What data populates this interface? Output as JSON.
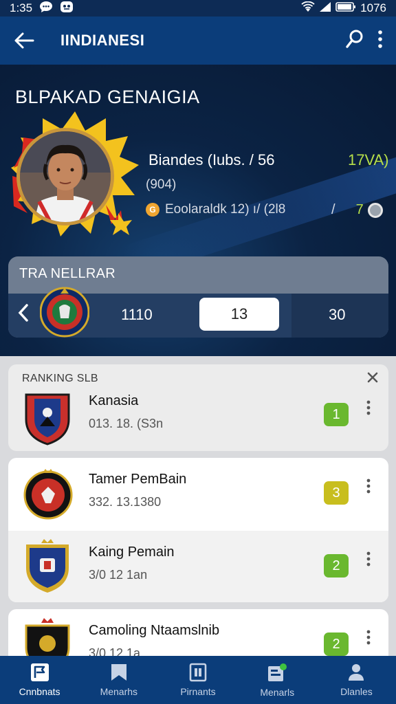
{
  "status_bar": {
    "time": "1:35",
    "battery_text": "1076"
  },
  "app_bar": {
    "title": "IINDIANESI"
  },
  "hero": {
    "title": "BLPAKAD GENAIGIA",
    "stat1": "Biandes (Iubs. /  56",
    "stat1_right": "17VA)",
    "stat2": "(904)",
    "stat3": "Eoolaraldk 12) ı/ (2l8",
    "stat3_sep": "/",
    "stat3_right": "7"
  },
  "transfer_panel": {
    "title": "TRA NELLRAR",
    "value_1": "1110",
    "value_2": "13",
    "value_3": "30"
  },
  "ranking": {
    "header": "RANKING SLB",
    "items": [
      {
        "name": "Kanasia",
        "sub": "013. 18. (S3n",
        "badge": "1",
        "badge_color": "#6ab82f"
      },
      {
        "name": "Tamer PemBain",
        "sub": "332. 13.1380",
        "badge": "3",
        "badge_color": "#c8be1e"
      },
      {
        "name": "Kaing Pemain",
        "sub": "3/0 12 1an",
        "badge": "2",
        "badge_color": "#6ab82f"
      },
      {
        "name": "Camoling Ntaamslnib",
        "sub": "3/0 12 1a",
        "badge": "2",
        "badge_color": "#6ab82f"
      }
    ]
  },
  "bottom_nav": [
    {
      "label": "Cnnbnats",
      "icon": "flag-icon"
    },
    {
      "label": "Menarhs",
      "icon": "bookmark-icon"
    },
    {
      "label": "Pirnants",
      "icon": "id-card-icon"
    },
    {
      "label": "Menarls",
      "icon": "news-icon"
    },
    {
      "label": "Dlanles",
      "icon": "person-icon"
    }
  ]
}
